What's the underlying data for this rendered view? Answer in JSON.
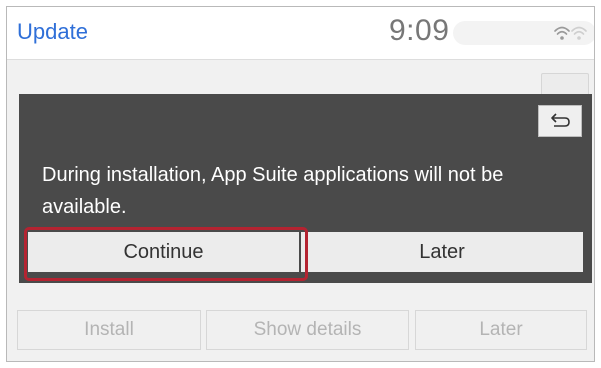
{
  "header": {
    "title": "Update",
    "time": "9:09"
  },
  "dialog": {
    "message": "During installation, App Suite applications will not be available.",
    "continue_label": "Continue",
    "later_label": "Later"
  },
  "bottom_bar": {
    "install_label": "Install",
    "show_details_label": "Show details",
    "later_label": "Later"
  },
  "icons": {
    "back": "back-arrow-icon",
    "wifi": "wifi-icon"
  },
  "colors": {
    "title_blue": "#2f6fd8",
    "dialog_bg": "#4a4a4a",
    "highlight_red": "#b42331",
    "progress_blue": "#3c74e0"
  }
}
